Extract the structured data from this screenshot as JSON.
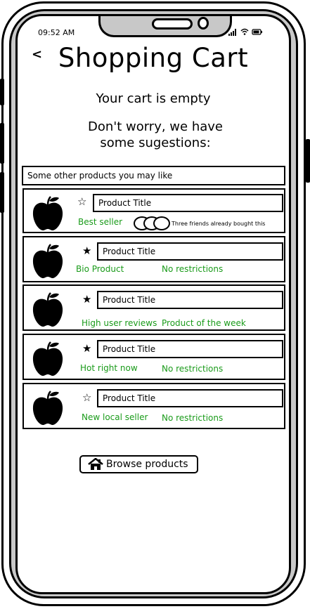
{
  "status_bar": {
    "time": "09:52 AM",
    "icons": "..ıl ≈ ▭"
  },
  "header": {
    "back_icon": "chevron-left-icon",
    "back_glyph": "<",
    "title": "Shopping Cart"
  },
  "messages": {
    "empty": "Your cart is empty",
    "suggest_line1": "Don't worry, we have",
    "suggest_line2": "some sugestions:"
  },
  "list": {
    "header": "Some other products you may like",
    "items": [
      {
        "title": "Product Title",
        "star": "half",
        "star_glyph": "☆",
        "tag1": "Best seller",
        "friends_text": "Three friends already bought this"
      },
      {
        "title": "Product Title",
        "star": "full",
        "star_glyph": "★",
        "tag1": "Bio Product",
        "tag2": "No restrictions"
      },
      {
        "title": "Product Title",
        "star": "full",
        "star_glyph": "★",
        "tag1": "High user reviews",
        "tag2": "Product of the week"
      },
      {
        "title": "Product Title",
        "star": "full",
        "star_glyph": "★",
        "tag1": "Hot right now",
        "tag2": "No restrictions"
      },
      {
        "title": "Product Title",
        "star": "half",
        "star_glyph": "☆",
        "tag1": "New local seller",
        "tag2": "No restrictions"
      }
    ]
  },
  "browse_button": {
    "label": "Browse products",
    "icon": "home-icon"
  },
  "colors": {
    "tag_green": "#1a9b1a",
    "frame": "#000000",
    "bezel": "#c8c8c8"
  }
}
